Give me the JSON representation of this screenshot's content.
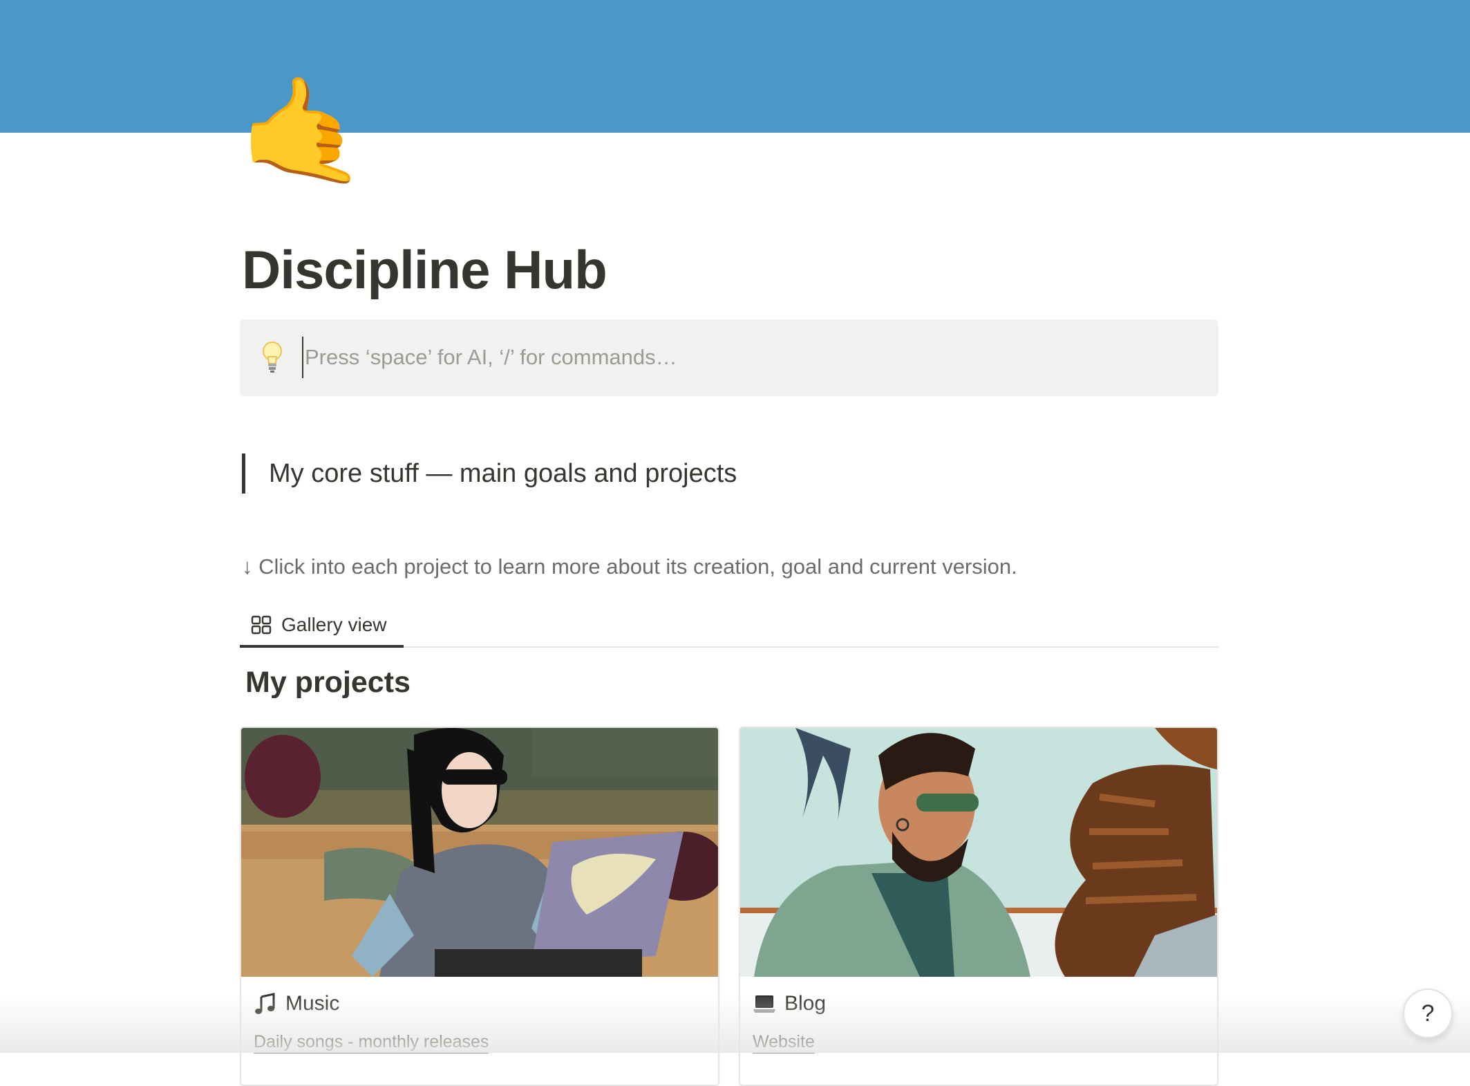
{
  "page": {
    "icon_name": "call-me-hand-icon",
    "icon_glyph": "🤙",
    "title": "Discipline Hub",
    "cover_color": "#4a97c9"
  },
  "ai_bar": {
    "icon_name": "lightbulb-icon",
    "placeholder": "Press ‘space’ for AI, ‘/’ for commands…"
  },
  "quote": "My core stuff — main goals and projects",
  "hint": "↓ Click into each project to learn more about its creation, goal and current version.",
  "tabs": [
    {
      "label": "Gallery view",
      "icon_name": "gallery-grid-icon",
      "active": true
    }
  ],
  "section_title": "My projects",
  "cards": [
    {
      "title": "Music",
      "icon_name": "musical-notes-icon",
      "subtitle": "Daily songs - monthly releases"
    },
    {
      "title": "Blog",
      "icon_name": "laptop-icon",
      "subtitle": "Website"
    }
  ],
  "help": {
    "label": "?"
  }
}
